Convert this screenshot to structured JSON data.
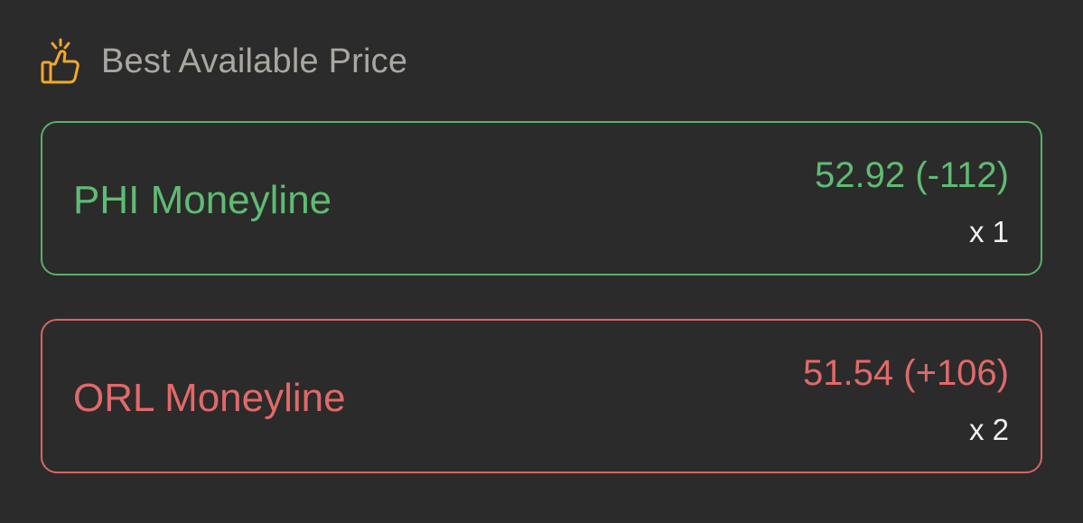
{
  "header": {
    "icon": "thumbs-up-sparkle-icon",
    "title": "Best Available Price",
    "icon_color": "#f2a72e"
  },
  "offers": [
    {
      "label": "PHI Moneyline",
      "price": "52.92 (-112)",
      "quantity": "x 1",
      "status_color": "#5fbb73"
    },
    {
      "label": "ORL Moneyline",
      "price": "51.54 (+106)",
      "quantity": "x 2",
      "status_color": "#e06a6a"
    }
  ]
}
